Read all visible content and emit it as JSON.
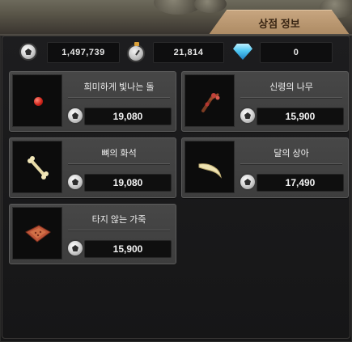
{
  "header": {
    "title": "상점 정보"
  },
  "currencies": [
    {
      "icon": "coin-icon",
      "value": "1,497,739"
    },
    {
      "icon": "stamina-icon",
      "value": "21,814"
    },
    {
      "icon": "gem-icon",
      "value": "0"
    }
  ],
  "items": [
    {
      "name": "희미하게 빛나는 돌",
      "price": "19,080",
      "icon": "glowing-stone-icon",
      "price_icon": "coin-icon"
    },
    {
      "name": "신령의 나무",
      "price": "15,900",
      "icon": "spirit-wood-icon",
      "price_icon": "coin-icon"
    },
    {
      "name": "뼈의 화석",
      "price": "19,080",
      "icon": "bone-fossil-icon",
      "price_icon": "coin-icon"
    },
    {
      "name": "달의 상아",
      "price": "17,490",
      "icon": "moon-ivory-icon",
      "price_icon": "coin-icon"
    },
    {
      "name": "타지 않는 가죽",
      "price": "15,900",
      "icon": "unburnt-leather-icon",
      "price_icon": "coin-icon"
    }
  ],
  "colors": {
    "panel": "#1d1d1f",
    "tab": "#b8966c",
    "card": "#444444",
    "gem": "#4fc7f2"
  }
}
